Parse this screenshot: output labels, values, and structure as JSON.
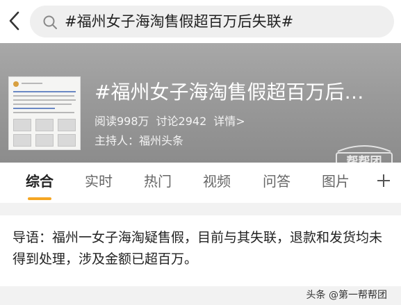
{
  "search": {
    "query": "#福州女子海淘售假超百万后失联#"
  },
  "topic": {
    "title": "#福州女子海淘售假超百万后…",
    "reads": "阅读998万",
    "discussions": "讨论2942",
    "details": "详情>",
    "host": "主持人：福州头条"
  },
  "watermark": {
    "text": "帮帮团"
  },
  "tabs": [
    {
      "label": "综合",
      "active": true
    },
    {
      "label": "实时",
      "active": false
    },
    {
      "label": "热门",
      "active": false
    },
    {
      "label": "视频",
      "active": false
    },
    {
      "label": "问答",
      "active": false
    },
    {
      "label": "图片",
      "active": false
    }
  ],
  "guide": {
    "text": "导语：福州一女子海淘疑售假，目前与其失联，退款和发货均未得到处理，涉及金额已超百万。"
  },
  "credit": {
    "text": "头条 @第一帮帮团"
  },
  "colors": {
    "accent": "#f5a623",
    "header_bg": "#9a9a9a"
  },
  "icons": [
    "back-arrow-icon",
    "search-icon",
    "plus-icon"
  ]
}
